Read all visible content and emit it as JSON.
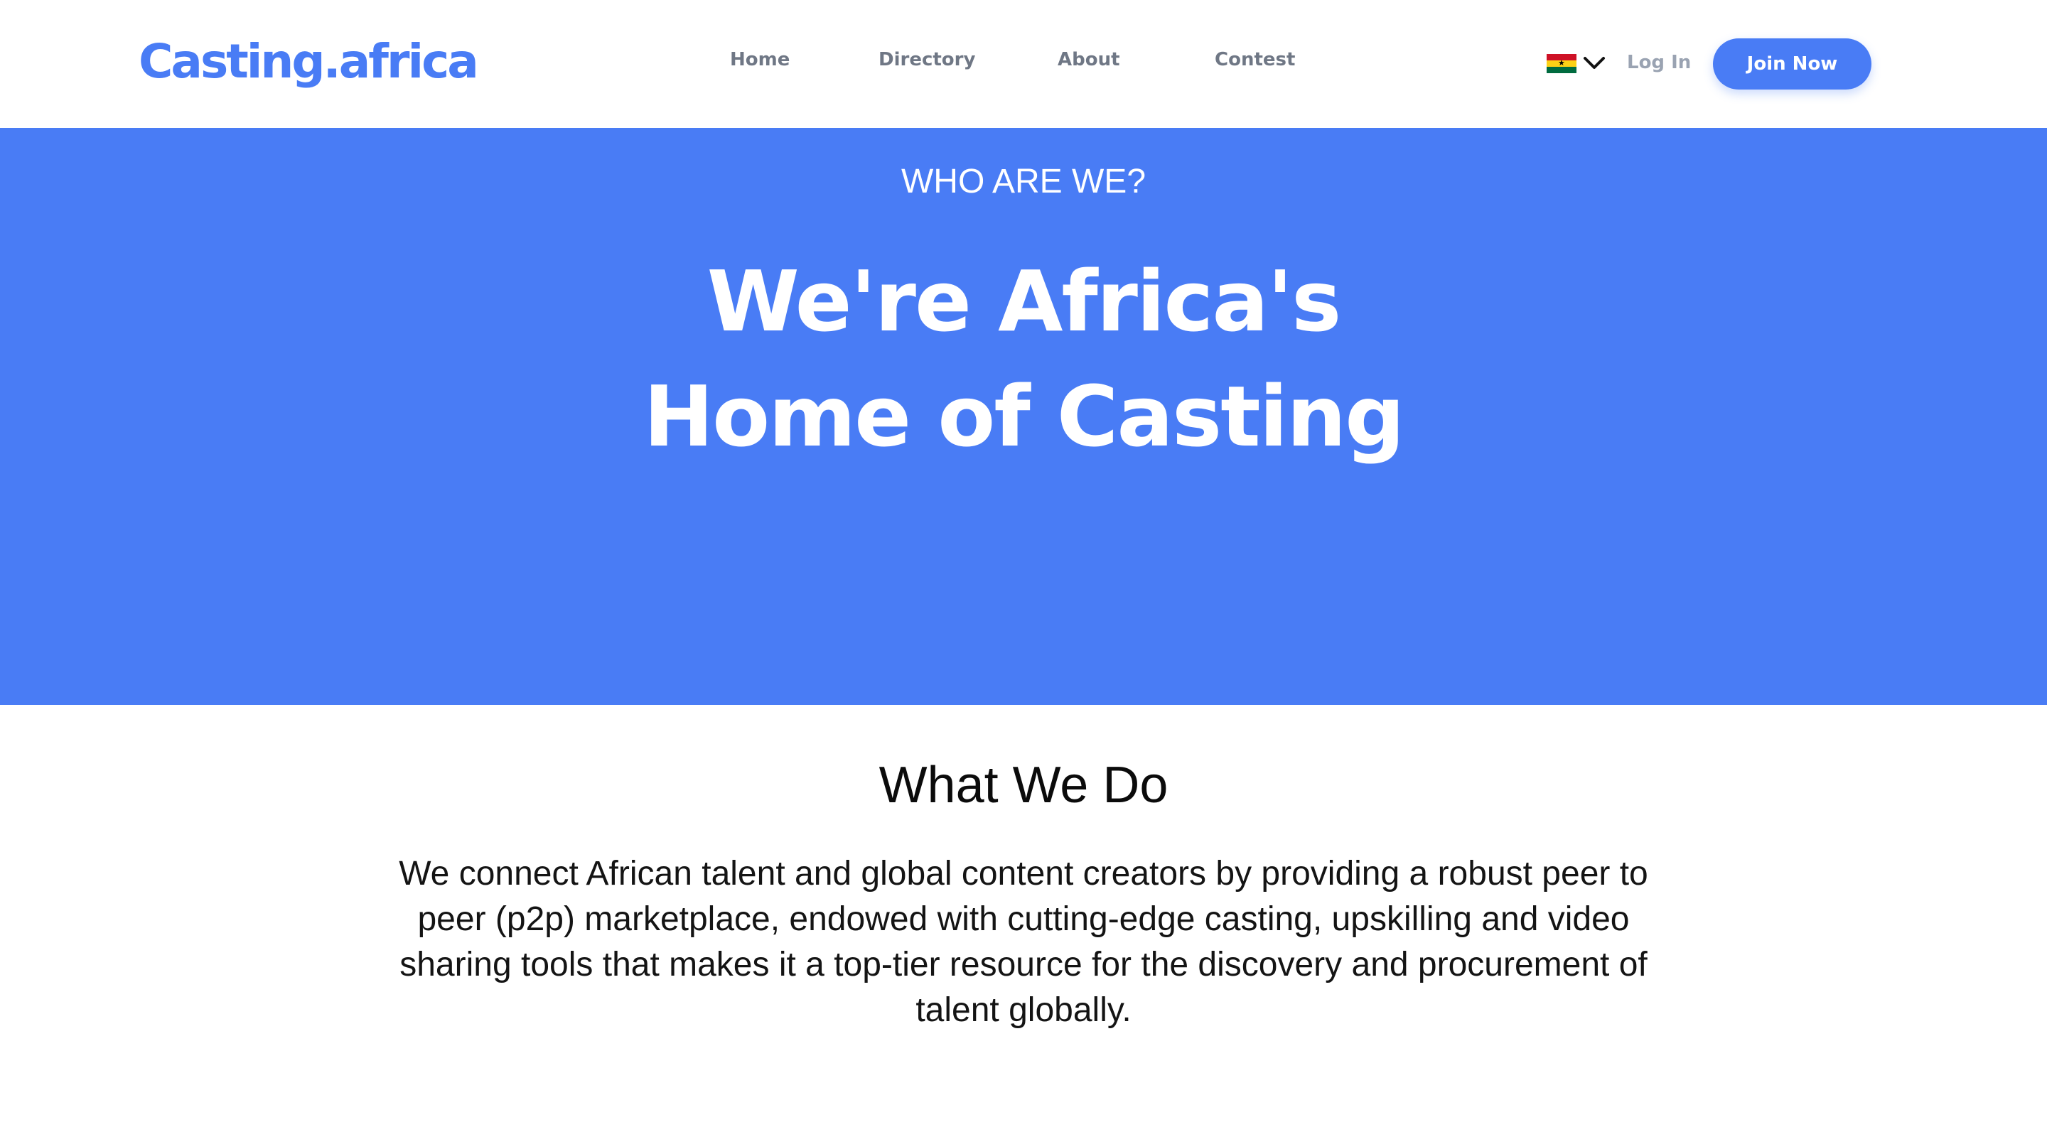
{
  "header": {
    "logo_text": "Casting.africa",
    "nav": {
      "home": "Home",
      "directory": "Directory",
      "about": "About",
      "contest": "Contest"
    },
    "language_flag": "ghana-flag-icon",
    "login_label": "Log In",
    "join_label": "Join Now"
  },
  "hero": {
    "eyebrow": "WHO ARE WE?",
    "title_line1": "We're Africa's",
    "title_line2": "Home of Casting"
  },
  "about": {
    "title": "What We Do",
    "body": "We connect African talent and global content creators by providing a robust peer to peer (p2p) marketplace, endowed with cutting-edge casting, upskilling and video sharing tools that makes it a top-tier resource for the discovery and procurement of talent globally."
  },
  "colors": {
    "brand_blue": "#497cf5",
    "nav_text": "#6f7785",
    "login_text": "#9aa3b2",
    "body_text": "#141414"
  }
}
